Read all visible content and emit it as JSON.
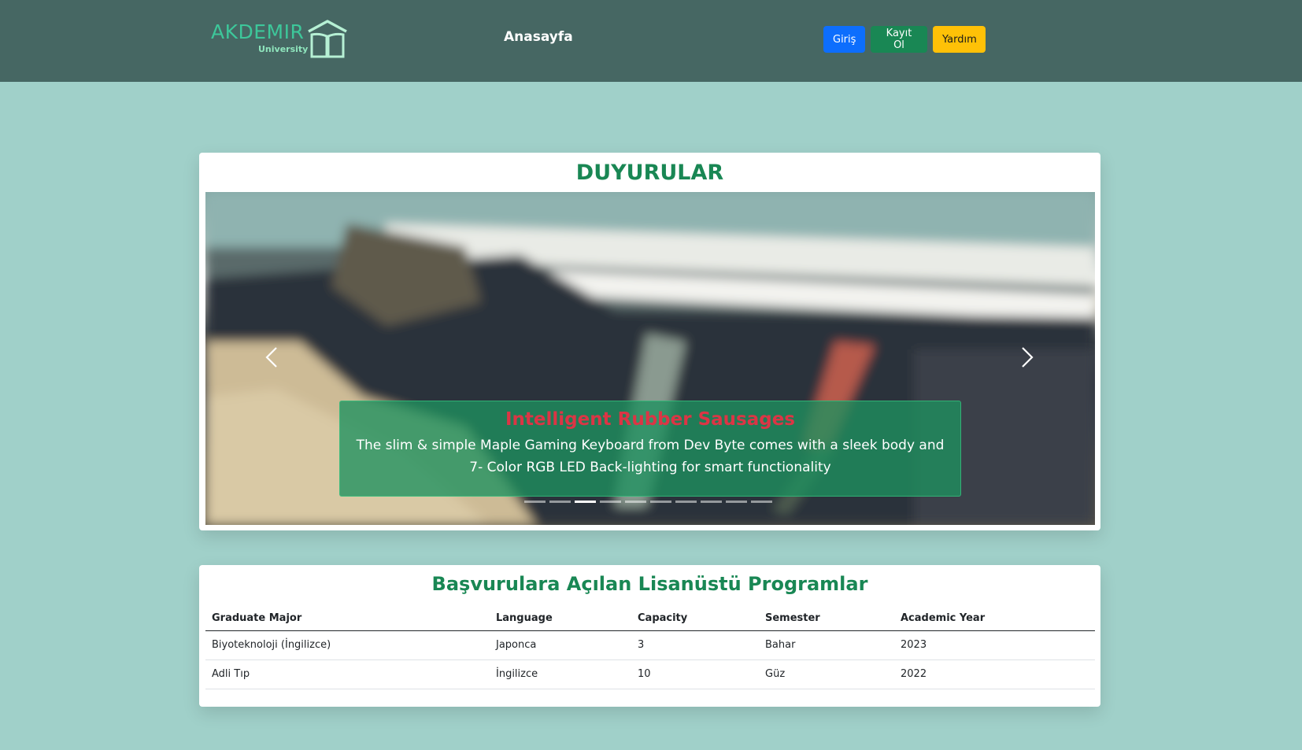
{
  "brand": {
    "name": "AKDEMIR",
    "subtitle": "University"
  },
  "nav": {
    "home_label": "Anasayfa"
  },
  "buttons": {
    "login": "Giriş",
    "register": "Kayıt Ol",
    "help": "Yardım"
  },
  "colors": {
    "navbar": "#466763",
    "background": "#a0d0c9",
    "accent_green": "#198754",
    "login_blue": "#0d6efd",
    "help_yellow": "#ffc107",
    "caption_title": "#dc3545"
  },
  "announcements": {
    "title": "DUYURULAR",
    "slide": {
      "title": "Intelligent Rubber Sausages",
      "text": "The slim & simple Maple Gaming Keyboard from Dev Byte comes with a sleek body and 7- Color RGB LED Back-lighting for smart functionality"
    },
    "indicator_count": 10,
    "active_index": 2,
    "prev_icon": "chevron-left-icon",
    "next_icon": "chevron-right-icon"
  },
  "programs": {
    "title": "Başvurulara Açılan Lisanüstü Programlar",
    "columns": [
      "Graduate Major",
      "Language",
      "Capacity",
      "Semester",
      "Academic Year"
    ],
    "rows": [
      [
        "Biyoteknoloji (İngilizce)",
        "Japonca",
        "3",
        "Bahar",
        "2023"
      ],
      [
        "Adli Tıp",
        "İngilizce",
        "10",
        "Güz",
        "2022"
      ]
    ]
  }
}
